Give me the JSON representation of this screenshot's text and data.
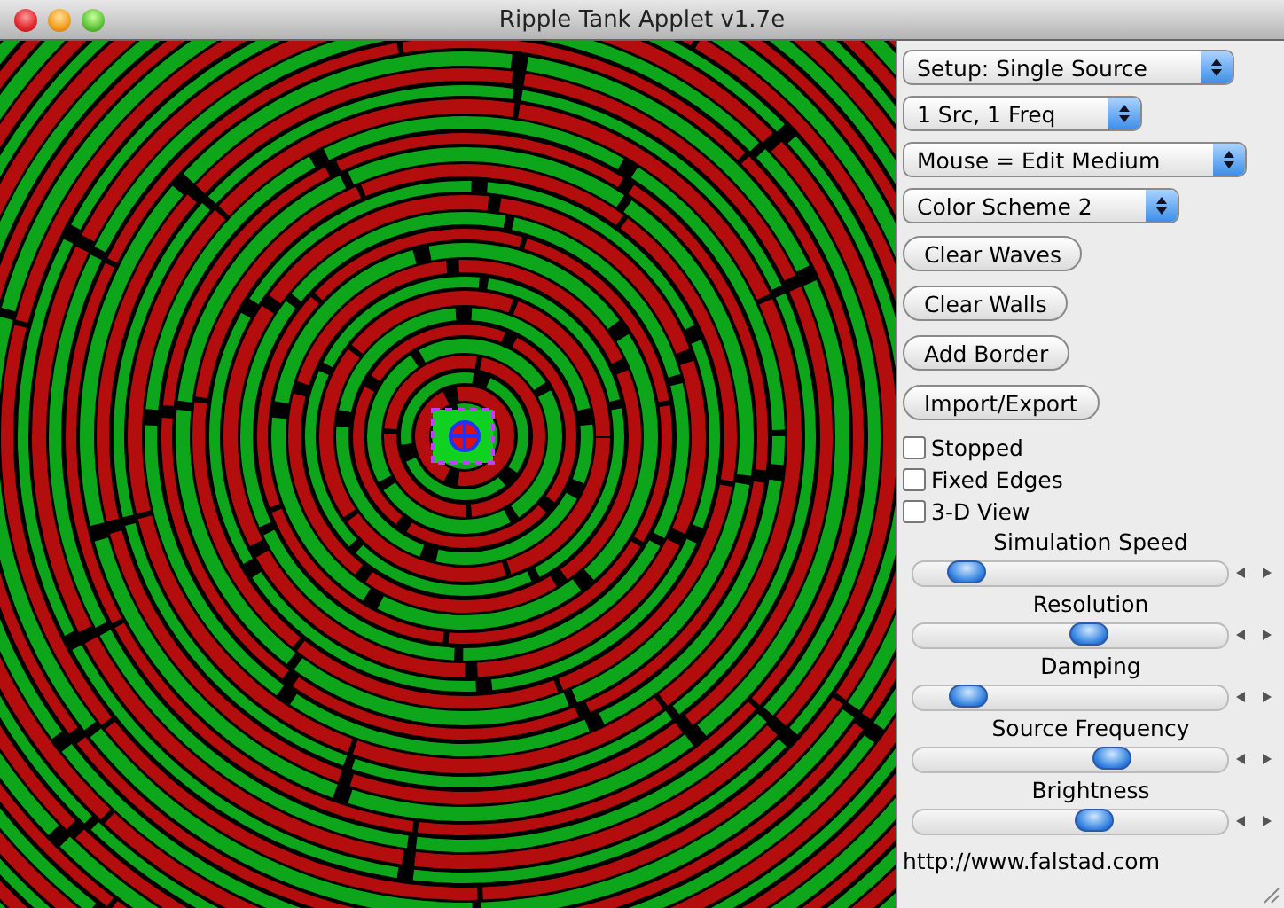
{
  "window": {
    "title": "Ripple Tank Applet v1.7e"
  },
  "dropdowns": [
    {
      "value": "Setup: Single Source"
    },
    {
      "value": "1 Src, 1 Freq"
    },
    {
      "value": "Mouse = Edit Medium"
    },
    {
      "value": "Color Scheme 2"
    }
  ],
  "buttons": [
    "Clear Waves",
    "Clear Walls",
    "Add Border",
    "Import/Export"
  ],
  "checkboxes": [
    {
      "label": "Stopped",
      "checked": false
    },
    {
      "label": "Fixed Edges",
      "checked": false
    },
    {
      "label": "3-D View",
      "checked": false
    }
  ],
  "sliders": [
    {
      "label": "Simulation Speed",
      "level": 0.12
    },
    {
      "label": "Resolution",
      "level": 0.57
    },
    {
      "label": "Damping",
      "level": 0.13
    },
    {
      "label": "Source Frequency",
      "level": 0.65
    },
    {
      "label": "Brightness",
      "level": 0.59
    }
  ],
  "footer": "http://www.falstad.com"
}
